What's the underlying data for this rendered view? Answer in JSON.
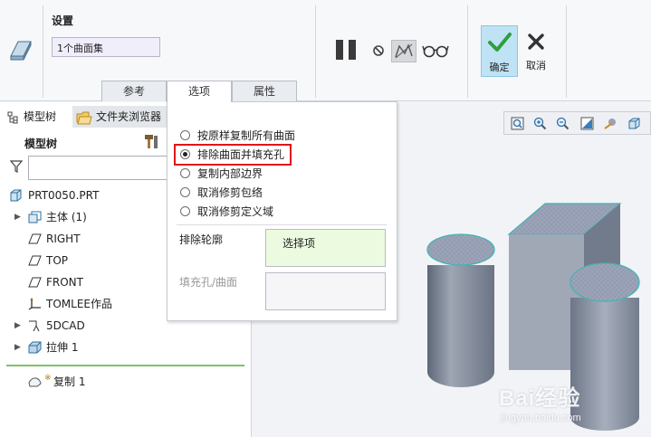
{
  "ribbon": {
    "settings_title": "设置",
    "surface_set_value": "1个曲面集",
    "tabs": [
      {
        "label": "参考",
        "active": false
      },
      {
        "label": "选项",
        "active": true
      },
      {
        "label": "属性",
        "active": false
      }
    ],
    "ok_label": "确定",
    "cancel_label": "取消",
    "accent_color": "#2e9e3e"
  },
  "options_panel": {
    "radios": [
      {
        "label": "按原样复制所有曲面",
        "selected": false
      },
      {
        "label": "排除曲面并填充孔",
        "selected": true
      },
      {
        "label": "复制内部边界",
        "selected": false
      },
      {
        "label": "取消修剪包络",
        "selected": false
      },
      {
        "label": "取消修剪定义域",
        "selected": false
      }
    ],
    "exclude_contour_label": "排除轮廓",
    "exclude_contour_value": "选择项",
    "fill_hole_label": "填充孔/曲面",
    "highlight_color": "#e0141b"
  },
  "left_panel": {
    "tab_model_tree": "模型树",
    "tab_folder_browser": "文件夹浏览器",
    "header": "模型树",
    "filter_placeholder": "",
    "items": [
      {
        "label": "PRT0050.PRT",
        "icon": "part-icon",
        "expandable": false
      },
      {
        "label": "主体 (1)",
        "icon": "body-icon",
        "expandable": true
      },
      {
        "label": "RIGHT",
        "icon": "datum-plane-icon",
        "expandable": false
      },
      {
        "label": "TOP",
        "icon": "datum-plane-icon",
        "expandable": false
      },
      {
        "label": "FRONT",
        "icon": "datum-plane-icon",
        "expandable": false
      },
      {
        "label": "TOMLEE作品",
        "icon": "coordinate-system-icon",
        "expandable": false
      },
      {
        "label": "5DCAD",
        "icon": "sketch-icon",
        "expandable": true
      },
      {
        "label": "拉伸 1",
        "icon": "extrude-icon",
        "expandable": true
      }
    ],
    "new_feature": {
      "prefix": "※",
      "label": "复制 1",
      "icon": "copy-surface-icon"
    }
  },
  "watermark": {
    "brand": "Bai经验",
    "url": "jingyan.baidu.com"
  }
}
